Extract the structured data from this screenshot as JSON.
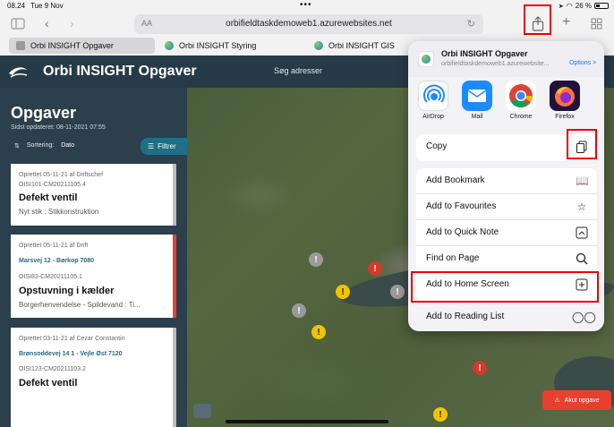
{
  "status_bar": {
    "time": "08.24",
    "date": "Tue 9 Nov",
    "battery": "26 %"
  },
  "address_bar": {
    "aa": "AA",
    "url": "orbifieldtaskdemoweb1.azurewebsites.net"
  },
  "tabs": [
    {
      "label": "Orbi INSIGHT Opgaver",
      "active": true
    },
    {
      "label": "Orbi INSIGHT Styring",
      "active": false
    },
    {
      "label": "Orbi INSIGHT GIS",
      "active": false
    }
  ],
  "app": {
    "title": "Orbi INSIGHT Opgaver",
    "search_placeholder": "Søg adresser"
  },
  "sidebar": {
    "title": "Opgaver",
    "updated": "Sidst opdateret: 08-11-2021 07:55",
    "sort_label": "Sortering:",
    "sort_value": "Dato",
    "filter_label": "Filtrer",
    "cards": [
      {
        "meta": "Oprettet 05-11-21 af Driftschef",
        "id": "OISI101-CM20211105.4",
        "title": "Defekt ventil",
        "subtitle": "Nyt stik : Stikkonstruktion",
        "address": "",
        "status_color": "#bdbdbd"
      },
      {
        "meta": "Oprettet 05-11-21 af Drift",
        "address": "Marsvej 12 - Børkop 7080",
        "id": "OISI83-CM20211105.1",
        "title": "Opstuvning i kælder",
        "subtitle": "Borgerhenvendelse - Spildevand : Ti...",
        "status_color": "#e8402f"
      },
      {
        "meta": "Oprettet 03-11-21 af Cezar Constantin",
        "address": "Brønsoddevej 14 1 - Vejle Øst 7120",
        "id": "OISI123-CM20211103.2",
        "title": "Defekt ventil",
        "subtitle": "",
        "status_color": "#bdbdbd"
      }
    ]
  },
  "share_sheet": {
    "site_title": "Orbi INSIGHT Opgaver",
    "site_url": "orbifieldtaskdemoweb1.azurewebsite...",
    "options_label": "Options >",
    "apps": [
      {
        "label": "AirDrop",
        "icon": "airdrop-icon"
      },
      {
        "label": "Mail",
        "icon": "mail-icon"
      },
      {
        "label": "Chrome",
        "icon": "chrome-icon"
      },
      {
        "label": "Firefox",
        "icon": "firefox-icon"
      }
    ],
    "copy_label": "Copy",
    "actions": [
      {
        "label": "Add Bookmark",
        "icon": "book-icon"
      },
      {
        "label": "Add to Favourites",
        "icon": "star-icon"
      },
      {
        "label": "Add to Quick Note",
        "icon": "quick-note-icon"
      },
      {
        "label": "Find on Page",
        "icon": "magnifier-icon"
      },
      {
        "label": "Add to Home Screen",
        "icon": "plus-square-icon"
      }
    ],
    "reading_list_label": "Add to Reading List"
  },
  "akut_label": "Akut opgave",
  "colors": {
    "header": "#263a47",
    "sidebar": "#2b3f4c",
    "accent": "#1f6f86",
    "alert": "#e8402f",
    "highlight": "#e00000"
  }
}
